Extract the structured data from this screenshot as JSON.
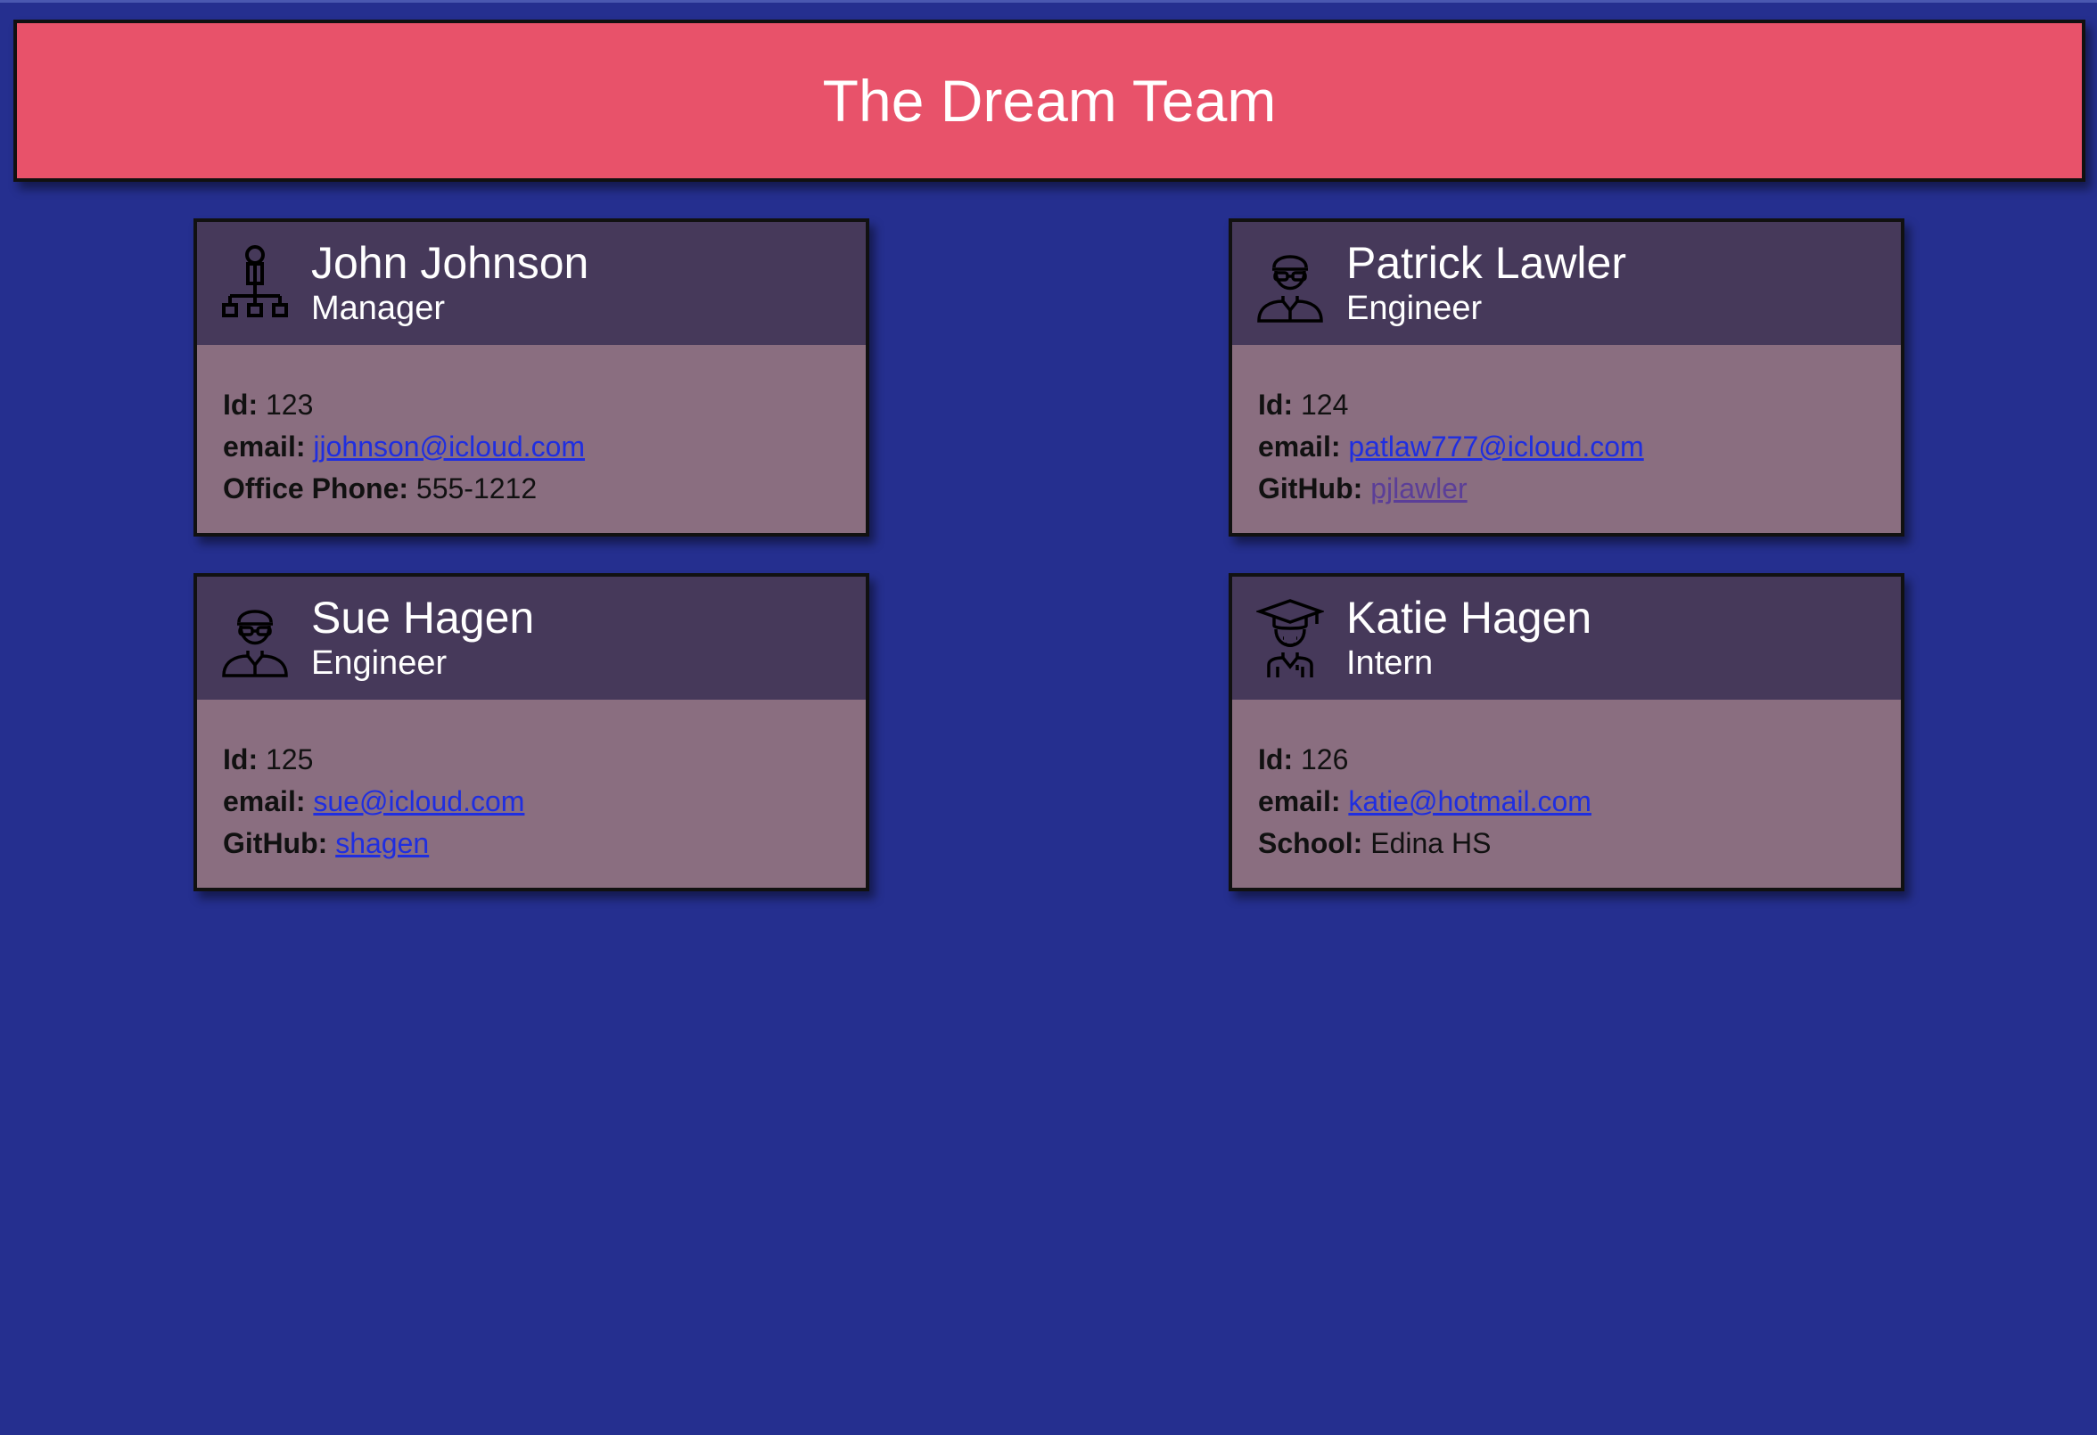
{
  "header": {
    "title": "The Dream Team"
  },
  "labels": {
    "id": "Id:",
    "email": "email:",
    "office_phone": "Office Phone:",
    "github": "GitHub:",
    "school": "School:"
  },
  "cards": [
    {
      "name": "John Johnson",
      "role": "Manager",
      "icon": "manager-org-chart-icon",
      "id": "123",
      "email": "jjohnson@icloud.com",
      "office_phone": "555-1212"
    },
    {
      "name": "Patrick Lawler",
      "role": "Engineer",
      "icon": "engineer-glasses-icon",
      "id": "124",
      "email": "patlaw777@icloud.com",
      "github": "pjlawler"
    },
    {
      "name": "Sue Hagen",
      "role": "Engineer",
      "icon": "engineer-glasses-icon",
      "id": "125",
      "email": "sue@icloud.com",
      "github": "shagen"
    },
    {
      "name": "Katie Hagen",
      "role": "Intern",
      "icon": "graduate-cap-icon",
      "id": "126",
      "email": "katie@hotmail.com",
      "school": "Edina HS"
    }
  ],
  "colors": {
    "background": "#252f8f",
    "banner": "#e8526a",
    "card_header": "#46395a",
    "card_body": "#8a6e80",
    "link": "#1f2ee0",
    "visited_link": "#5b3e98"
  }
}
